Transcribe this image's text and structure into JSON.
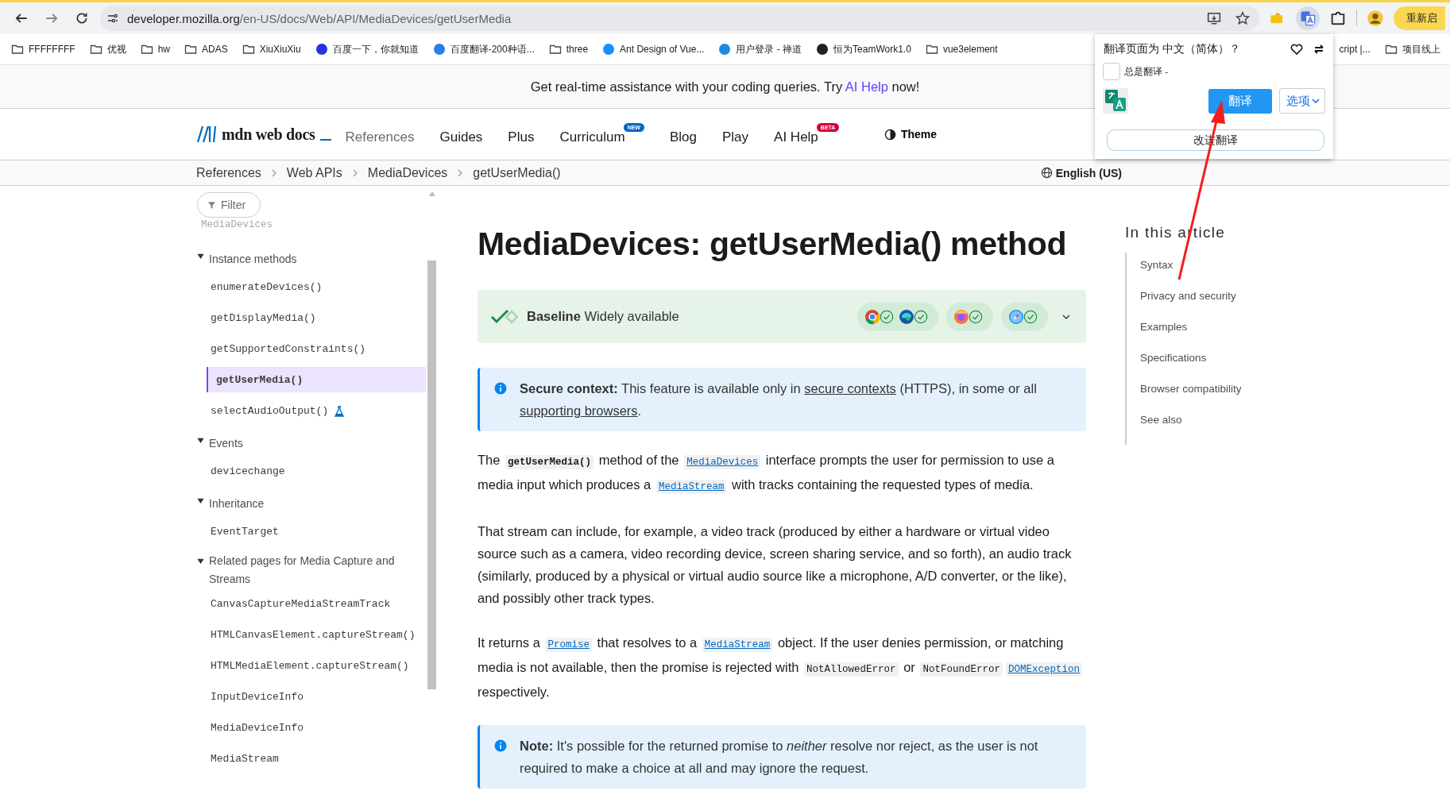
{
  "browser": {
    "url_host": "developer.mozilla.org",
    "url_path": "/en-US/docs/Web/API/MediaDevices/getUserMedia",
    "restart_button": "重新启",
    "bookmarks": [
      {
        "kind": "folder",
        "label": "FFFFFFFF"
      },
      {
        "kind": "folder",
        "label": "优视"
      },
      {
        "kind": "folder",
        "label": "hw"
      },
      {
        "kind": "folder",
        "label": "ADAS"
      },
      {
        "kind": "folder",
        "label": "XiuXiuXiu"
      },
      {
        "kind": "site",
        "label": "百度一下，你就知道",
        "color": "#2932e1"
      },
      {
        "kind": "site",
        "label": "百度翻译-200种语...",
        "color": "#2b7de9"
      },
      {
        "kind": "folder",
        "label": "three"
      },
      {
        "kind": "site",
        "label": "Ant Design of Vue...",
        "color": "#1890ff"
      },
      {
        "kind": "site",
        "label": "用户登录 - 禅道",
        "color": "#1e88e5"
      },
      {
        "kind": "site",
        "label": "恒为TeamWork1.0",
        "color": "#222222"
      },
      {
        "kind": "folder",
        "label": "vue3element"
      },
      {
        "kind": "hidden",
        "label": "cript |..."
      },
      {
        "kind": "folder",
        "label": "项目线上"
      }
    ]
  },
  "translate_popup": {
    "title": "翻译页面为 中文（简体）？",
    "always_label": "总是翻译 -",
    "always_checked": false,
    "translate_button": "翻译",
    "options_button": "选项",
    "improve_button": "改进翻译"
  },
  "banner": {
    "before": "Get real-time assistance with your coding queries. Try ",
    "link": "AI Help",
    "after": " now!"
  },
  "header": {
    "logo": "mdn web docs",
    "nav": [
      {
        "label": "References",
        "selected": true
      },
      {
        "label": "Guides",
        "selected": false
      },
      {
        "label": "Plus",
        "selected": false
      },
      {
        "label": "Curriculum",
        "selected": false,
        "badge": "NEW",
        "color": "#0069c2"
      },
      {
        "label": "Blog",
        "selected": false
      },
      {
        "label": "Play",
        "selected": false
      },
      {
        "label": "AI Help",
        "selected": false,
        "badge": "BETA",
        "color": "#d30038"
      }
    ],
    "theme": "Theme"
  },
  "breadcrumbs": [
    "References",
    "Web APIs",
    "MediaDevices",
    "getUserMedia()"
  ],
  "language": "English (US)",
  "sidebar": {
    "filter": "Filter",
    "faded_item": "MediaDevices",
    "sections": [
      {
        "title": "Instance methods",
        "expanded": true,
        "items": [
          {
            "label": "enumerateDevices()",
            "selected": false,
            "experimental": false
          },
          {
            "label": "getDisplayMedia()",
            "selected": false,
            "experimental": false
          },
          {
            "label": "getSupportedConstraints()",
            "selected": false,
            "experimental": false
          },
          {
            "label": "getUserMedia()",
            "selected": true,
            "experimental": false
          },
          {
            "label": "selectAudioOutput()",
            "selected": false,
            "experimental": true
          }
        ]
      },
      {
        "title": "Events",
        "expanded": true,
        "items": [
          {
            "label": "devicechange",
            "selected": false,
            "experimental": false
          }
        ]
      },
      {
        "title": "Inheritance",
        "expanded": true,
        "items": [
          {
            "label": "EventTarget",
            "selected": false,
            "experimental": false
          }
        ]
      },
      {
        "title": "Related pages for Media Capture and Streams",
        "expanded": true,
        "items": [
          {
            "label": "CanvasCaptureMediaStreamTrack",
            "selected": false,
            "experimental": false
          },
          {
            "label": "HTMLCanvasElement.captureStream()",
            "selected": false,
            "experimental": false
          },
          {
            "label": "HTMLMediaElement.captureStream()",
            "selected": false,
            "experimental": false
          },
          {
            "label": "InputDeviceInfo",
            "selected": false,
            "experimental": false
          },
          {
            "label": "MediaDeviceInfo",
            "selected": false,
            "experimental": false
          },
          {
            "label": "MediaStream",
            "selected": false,
            "experimental": false
          }
        ]
      }
    ]
  },
  "article": {
    "title": "MediaDevices: getUserMedia() method",
    "baseline": {
      "text": "**Baseline** Widely available",
      "groups": [
        {
          "browsers": [
            {
              "kind": "chrome",
              "supported": true
            },
            {
              "kind": "edge",
              "supported": true
            }
          ]
        },
        {
          "browsers": [
            {
              "kind": "firefox",
              "supported": true
            }
          ]
        },
        {
          "browsers": [
            {
              "kind": "safari",
              "supported": true
            }
          ]
        }
      ]
    },
    "callouts_and_paragraphs": [
      {
        "kind": "callout",
        "parts": [
          {
            "kind": "text",
            "text": "**Secure context:** This feature is available only in "
          },
          {
            "kind": "link",
            "text": "secure contexts"
          },
          {
            "kind": "text",
            "text": " (HTTPS), in some or all "
          },
          {
            "kind": "link",
            "text": "supporting browsers"
          },
          {
            "kind": "text",
            "text": "."
          }
        ]
      },
      {
        "kind": "paragraph",
        "parts": [
          {
            "kind": "text",
            "text": "The "
          },
          {
            "kind": "code_strong",
            "text": "getUserMedia()"
          },
          {
            "kind": "text",
            "text": " method of the "
          },
          {
            "kind": "code_link",
            "text": "MediaDevices"
          },
          {
            "kind": "text",
            "text": " interface prompts the user for permission to use a media input which produces a "
          },
          {
            "kind": "code_link",
            "text": "MediaStream"
          },
          {
            "kind": "text",
            "text": " with tracks containing the requested types of media."
          }
        ]
      },
      {
        "kind": "paragraph",
        "parts": [
          {
            "kind": "text",
            "text": "That stream can include, for example, a video track (produced by either a hardware or virtual video source such as a camera, video recording device, screen sharing service, and so forth), an audio track (similarly, produced by a physical or virtual audio source like a microphone, A/D converter, or the like), and possibly other track types."
          }
        ]
      },
      {
        "kind": "paragraph",
        "parts": [
          {
            "kind": "text",
            "text": "It returns a "
          },
          {
            "kind": "code_link",
            "text": "Promise"
          },
          {
            "kind": "text",
            "text": " that resolves to a "
          },
          {
            "kind": "code_link",
            "text": "MediaStream"
          },
          {
            "kind": "text",
            "text": " object. If the user denies permission, or matching media is not available, then the promise is rejected with "
          },
          {
            "kind": "code",
            "text": "NotAllowedError"
          },
          {
            "kind": "text",
            "text": " or "
          },
          {
            "kind": "code",
            "text": "NotFoundError"
          },
          {
            "kind": "code_link",
            "text": "DOMException"
          },
          {
            "kind": "text",
            "text": " respectively."
          }
        ]
      },
      {
        "kind": "callout",
        "parts": [
          {
            "kind": "text",
            "text": "**Note:** It's possible for the returned promise to *neither* resolve nor reject, as the user is not required to make a choice at all and may ignore the request."
          }
        ]
      }
    ]
  },
  "toc": {
    "title": "In this article",
    "items": [
      "Syntax",
      "Privacy and security",
      "Examples",
      "Specifications",
      "Browser compatibility",
      "See also"
    ]
  }
}
